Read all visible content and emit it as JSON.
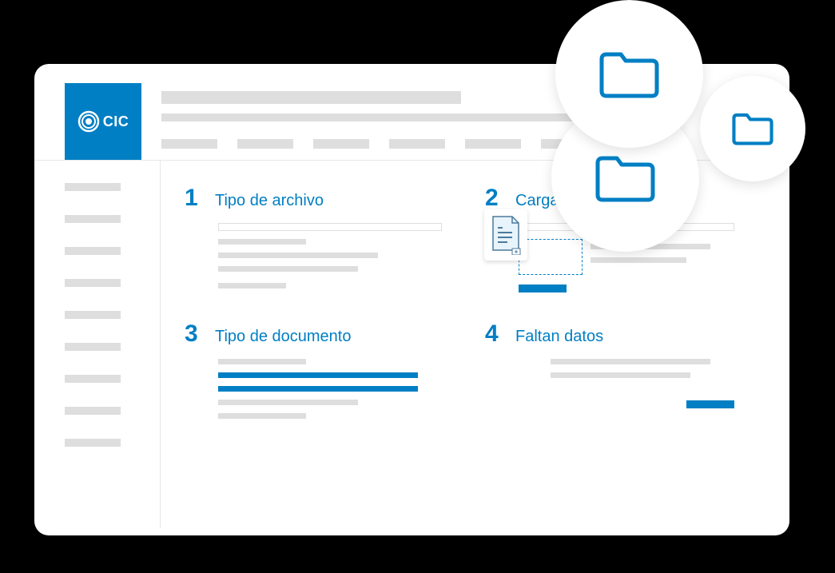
{
  "logo": {
    "text": "CIC"
  },
  "colors": {
    "primary": "#007fc4",
    "placeholder": "#dedede"
  },
  "steps": [
    {
      "number": "1",
      "title": "Tipo de archivo"
    },
    {
      "number": "2",
      "title": "Cargar archivo"
    },
    {
      "number": "3",
      "title": "Tipo de documento"
    },
    {
      "number": "4",
      "title": "Faltan datos"
    }
  ]
}
